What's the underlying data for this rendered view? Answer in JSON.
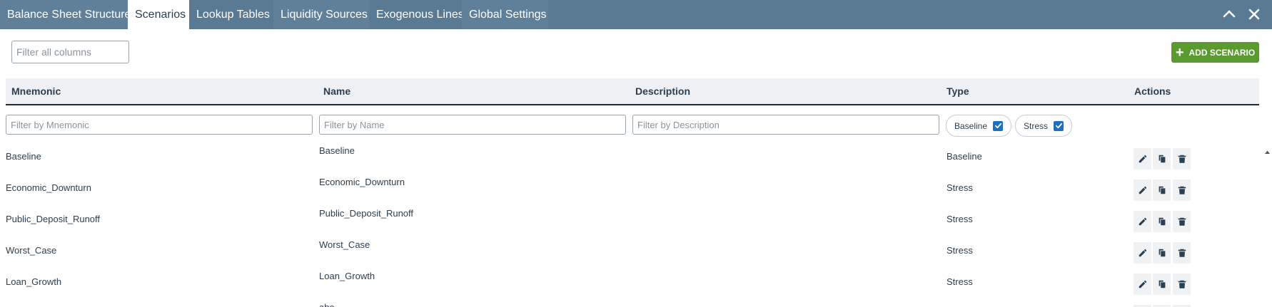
{
  "tabs": [
    {
      "label": "Balance Sheet Structure",
      "active": false
    },
    {
      "label": "Scenarios",
      "active": true
    },
    {
      "label": "Lookup Tables",
      "active": false
    },
    {
      "label": "Liquidity Sources",
      "active": false
    },
    {
      "label": "Exogenous Lines",
      "active": false
    },
    {
      "label": "Global Settings",
      "active": false
    }
  ],
  "window": {
    "collapse_icon": "chevron-up-icon",
    "close_icon": "close-icon"
  },
  "toolbar": {
    "filter_placeholder": "Filter all columns",
    "add_label": "ADD SCENARIO",
    "add_color": "#5a9a2e"
  },
  "table": {
    "columns": [
      "Mnemonic",
      "Name",
      "Description",
      "Type",
      "Actions"
    ],
    "filters": {
      "mnemonic": "Filter by Mnemonic",
      "name": "Filter by Name",
      "description": "Filter by Description"
    },
    "type_filters": [
      {
        "label": "Baseline",
        "checked": true
      },
      {
        "label": "Stress",
        "checked": true
      }
    ],
    "rows": [
      {
        "mnemonic": "Baseline",
        "name": "Baseline",
        "description": "",
        "type": "Baseline"
      },
      {
        "mnemonic": "Economic_Downturn",
        "name": "Economic_Downturn",
        "description": "",
        "type": "Stress"
      },
      {
        "mnemonic": "Public_Deposit_Runoff",
        "name": "Public_Deposit_Runoff",
        "description": "",
        "type": "Stress"
      },
      {
        "mnemonic": "Worst_Case",
        "name": "Worst_Case",
        "description": "",
        "type": "Stress"
      },
      {
        "mnemonic": "Loan_Growth",
        "name": "Loan_Growth",
        "description": "",
        "type": "Stress"
      },
      {
        "mnemonic": "",
        "name": "abc",
        "description": "",
        "type": ""
      }
    ],
    "row_actions": [
      "edit-icon",
      "copy-icon",
      "delete-icon"
    ]
  },
  "colors": {
    "header_bar": "#5a7a93",
    "header_row": "#eef0f3",
    "checkbox": "#1f6fbf",
    "text": "#2b3f52"
  }
}
